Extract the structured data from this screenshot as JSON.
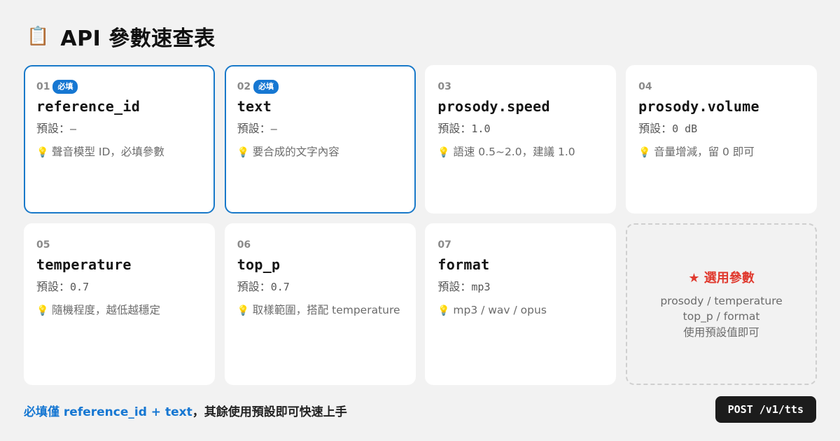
{
  "title": {
    "icon": "clipboard-icon",
    "glyph": "📋",
    "text": "API 參數速查表"
  },
  "colors": {
    "accent": "#1677d2",
    "card_border_required": "#1979c9",
    "optional_title": "#e03a2f",
    "background": "#f2f2f2",
    "endpoint_bg": "#1c1c1c"
  },
  "cards": [
    {
      "num": "01",
      "badge": "必填",
      "required": true,
      "param": "reference_id",
      "default_label": "預設：",
      "default_value": "—",
      "tip_icon": "lightbulb-icon",
      "tip_glyph": "💡",
      "tip": "聲音模型 ID，必填參數"
    },
    {
      "num": "02",
      "badge": "必填",
      "required": true,
      "param": "text",
      "default_label": "預設：",
      "default_value": "—",
      "tip_icon": "lightbulb-icon",
      "tip_glyph": "💡",
      "tip": "要合成的文字內容"
    },
    {
      "num": "03",
      "required": false,
      "param": "prosody.speed",
      "default_label": "預設：",
      "default_value": "1.0",
      "tip_icon": "lightbulb-icon",
      "tip_glyph": "💡",
      "tip": "語速 0.5~2.0，建議 1.0"
    },
    {
      "num": "04",
      "required": false,
      "param": "prosody.volume",
      "default_label": "預設：",
      "default_value": "0 dB",
      "tip_icon": "lightbulb-icon",
      "tip_glyph": "💡",
      "tip": "音量增減，留 0 即可"
    },
    {
      "num": "05",
      "required": false,
      "param": "temperature",
      "default_label": "預設：",
      "default_value": "0.7",
      "tip_icon": "lightbulb-icon",
      "tip_glyph": "💡",
      "tip": "隨機程度，越低越穩定"
    },
    {
      "num": "06",
      "required": false,
      "param": "top_p",
      "default_label": "預設：",
      "default_value": "0.7",
      "tip_icon": "lightbulb-icon",
      "tip_glyph": "💡",
      "tip": "取樣範圍，搭配 temperature"
    },
    {
      "num": "07",
      "required": false,
      "param": "format",
      "default_label": "預設：",
      "default_value": "mp3",
      "tip_icon": "lightbulb-icon",
      "tip_glyph": "💡",
      "tip": "mp3 / wav / opus"
    }
  ],
  "optional_card": {
    "title": "★ 選用參數",
    "line1": "prosody / temperature",
    "line2": "top_p / format",
    "line3": "使用預設值即可"
  },
  "footer": {
    "highlight": "必填僅 reference_id + text",
    "rest": "，其餘使用預設即可快速上手"
  },
  "endpoint": {
    "label": "POST /v1/tts"
  }
}
